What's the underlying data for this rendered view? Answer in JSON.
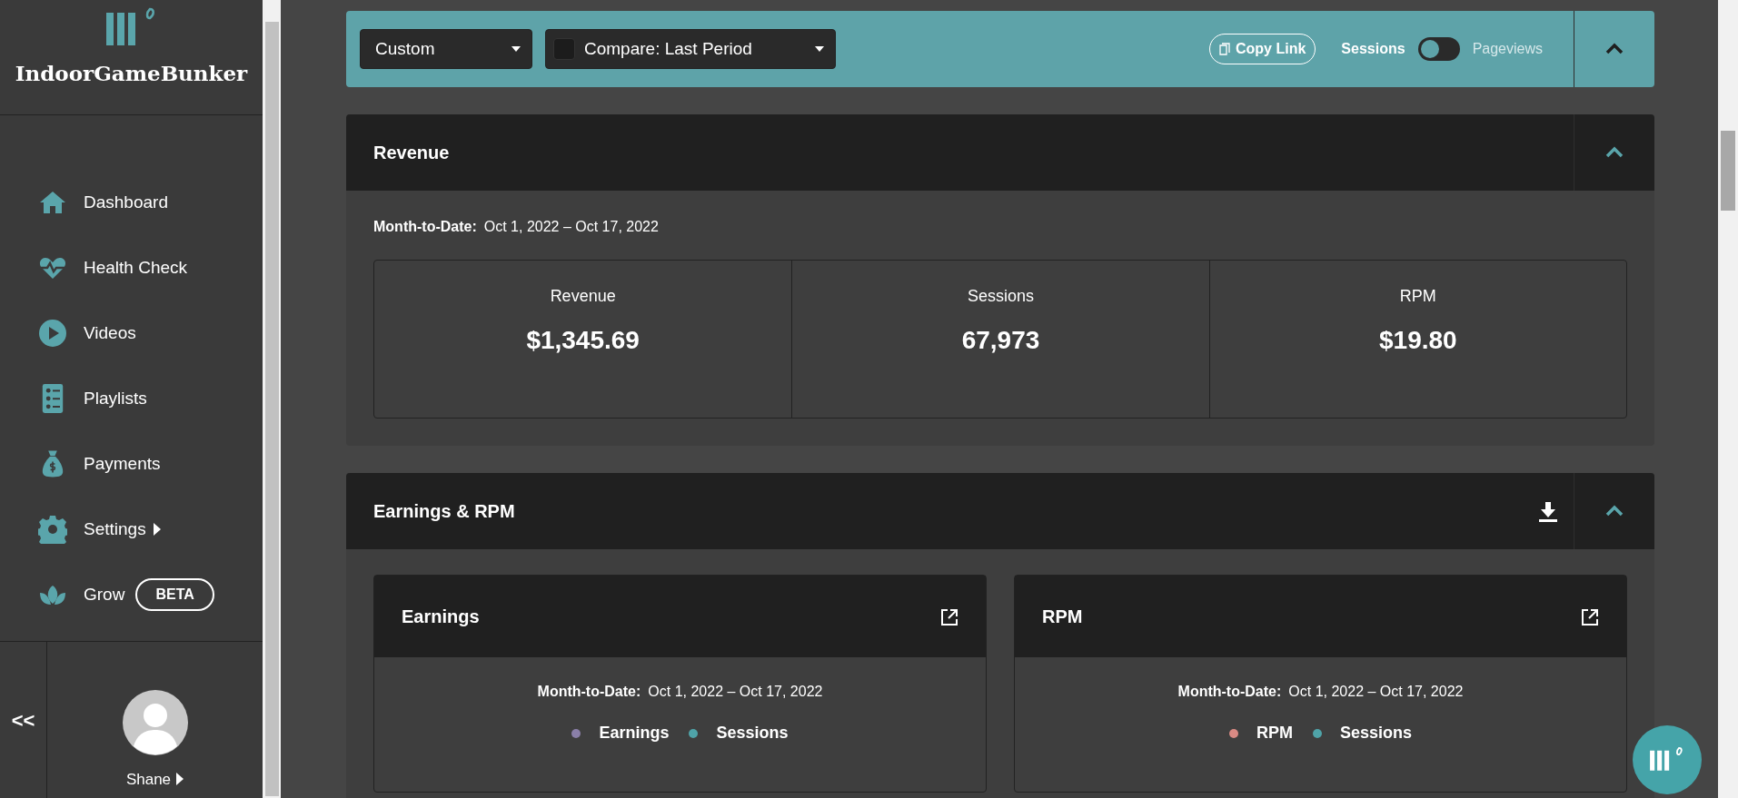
{
  "sidebar": {
    "brand": "IndoorGameBunker",
    "items": [
      {
        "label": "Dashboard",
        "has_submenu": false
      },
      {
        "label": "Health Check",
        "has_submenu": false
      },
      {
        "label": "Videos",
        "has_submenu": false
      },
      {
        "label": "Playlists",
        "has_submenu": false
      },
      {
        "label": "Payments",
        "has_submenu": false
      },
      {
        "label": "Settings",
        "has_submenu": true
      },
      {
        "label": "Grow",
        "has_submenu": false,
        "badge": "BETA"
      }
    ],
    "collapse": "<<",
    "user": {
      "name": "Shane"
    }
  },
  "toolbar": {
    "range": "Custom",
    "compare": {
      "label": "Compare: Last Period",
      "checked": false
    },
    "copy_link": "Copy Link",
    "metric_toggle": {
      "on": false,
      "off_label": "Sessions",
      "on_label": "Pageviews"
    },
    "expanded": true
  },
  "revenue": {
    "title": "Revenue",
    "expanded": true,
    "period_label": "Month-to-Date:",
    "period": "Oct 1, 2022 – Oct 17, 2022",
    "stats": [
      {
        "label": "Revenue",
        "value": "$1,345.69"
      },
      {
        "label": "Sessions",
        "value": "67,973"
      },
      {
        "label": "RPM",
        "value": "$19.80"
      }
    ]
  },
  "earnings_rpm": {
    "title": "Earnings & RPM",
    "expanded": true,
    "cards": [
      {
        "title": "Earnings",
        "period_label": "Month-to-Date:",
        "period": "Oct 1, 2022 – Oct 17, 2022",
        "legend": [
          {
            "label": "Earnings",
            "color": "#8a7fa8"
          },
          {
            "label": "Sessions",
            "color": "#4fa3a8"
          }
        ]
      },
      {
        "title": "RPM",
        "period_label": "Month-to-Date:",
        "period": "Oct 1, 2022 – Oct 17, 2022",
        "legend": [
          {
            "label": "RPM",
            "color": "#d98a84"
          },
          {
            "label": "Sessions",
            "color": "#4fa3a8"
          }
        ]
      }
    ]
  }
}
